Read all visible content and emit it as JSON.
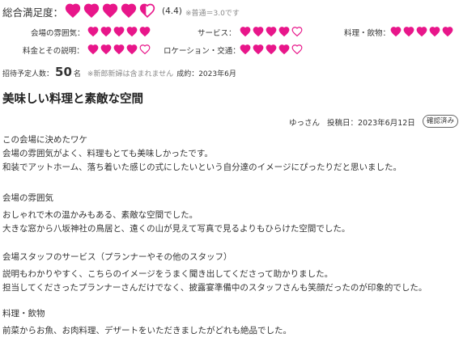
{
  "colors": {
    "accent": "#e8168a",
    "text": "#333333",
    "muted": "#888888"
  },
  "overall": {
    "label": "総合満足度：",
    "rating": 4.4,
    "rating_text": "(4.4)",
    "note": "※普通＝3.0です"
  },
  "categories": [
    {
      "label": "会場の雰囲気：",
      "rating": 5
    },
    {
      "label": "サービス：",
      "rating": 4
    },
    {
      "label": "料理・飲物：",
      "rating": 5
    },
    {
      "label": "料金とその説明：",
      "rating": 4
    },
    {
      "label": "ロケーション・交通：",
      "rating": 4
    }
  ],
  "guests": {
    "label": "招待予定人数：",
    "count": "50",
    "unit": "名",
    "note": "※新郎新婦は含まれません",
    "contract": "成約：2023年6月"
  },
  "review": {
    "title": "美味しい料理と素敵な空間",
    "author": "ゆっさん",
    "date": "投稿日：2023年6月12日",
    "badge": "確認済み",
    "sections": [
      {
        "heading": "この会場に決めたワケ",
        "lines": [
          "会場の雰囲気がよく、料理もとても美味しかったです。",
          "和装でアットホーム、落ち着いた感じの式にしたいという自分達のイメージにぴったりだと思いました。"
        ]
      },
      {
        "heading": "会場の雰囲気",
        "lines": [
          "おしゃれで木の温かみもある、素敵な空間でした。",
          "大きな窓から八坂神社の鳥居と、遠くの山が見えて写真で見るよりもひらけた空間でした。"
        ]
      },
      {
        "heading": "会場スタッフのサービス（プランナーやその他のスタッフ）",
        "lines": [
          "説明もわかりやすく、こちらのイメージをうまく聞き出してくださって助かりました。",
          "担当してくださったプランナーさんだけでなく、披露宴準備中のスタッフさんも笑顔だったのが印象的でした。"
        ]
      },
      {
        "heading": "料理・飲物",
        "lines": [
          "前菜からお魚、お肉料理、デザートをいただきましたがどれも絶品でした。"
        ]
      }
    ]
  }
}
